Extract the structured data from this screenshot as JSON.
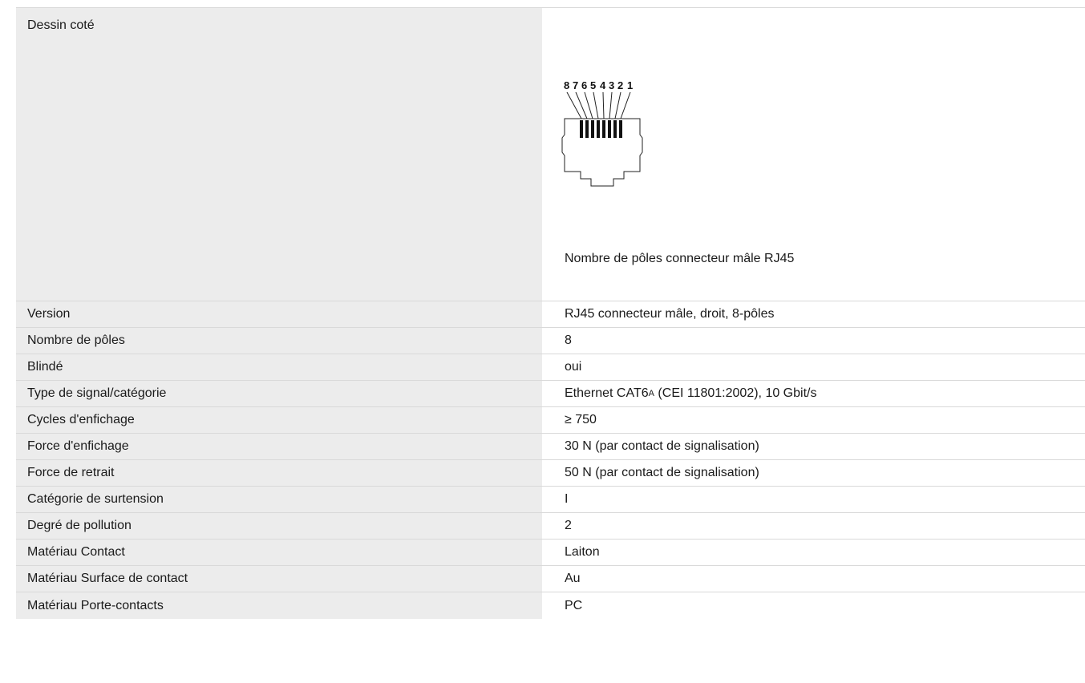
{
  "drawing": {
    "label": "Dessin coté",
    "pin_numbers": [
      "8",
      "7",
      "6",
      "5",
      "4",
      "3",
      "2",
      "1"
    ],
    "caption": "Nombre de pôles connecteur mâle RJ45"
  },
  "rows": [
    {
      "label": "Version",
      "value": "RJ45 connecteur mâle, droit, 8-pôles"
    },
    {
      "label": "Nombre de pôles",
      "value": "8"
    },
    {
      "label": "Blindé",
      "value": "oui"
    },
    {
      "label": "Type de signal/catégorie",
      "value_prefix": "Ethernet CAT6",
      "value_sub": "A",
      "value_suffix": " (CEI 11801:2002), 10 Gbit/s"
    },
    {
      "label": "Cycles d'enfichage",
      "value": "≥ 750"
    },
    {
      "label": "Force d'enfichage",
      "value": "30 N (par contact de signalisation)"
    },
    {
      "label": "Force de retrait",
      "value": "50 N (par contact de signalisation)"
    },
    {
      "label": "Catégorie de surtension",
      "value": "I"
    },
    {
      "label": "Degré de pollution",
      "value": "2"
    },
    {
      "label": "Matériau Contact",
      "value": "Laiton"
    },
    {
      "label": "Matériau Surface de contact",
      "value": "Au"
    },
    {
      "label": "Matériau Porte-contacts",
      "value": "PC"
    }
  ]
}
